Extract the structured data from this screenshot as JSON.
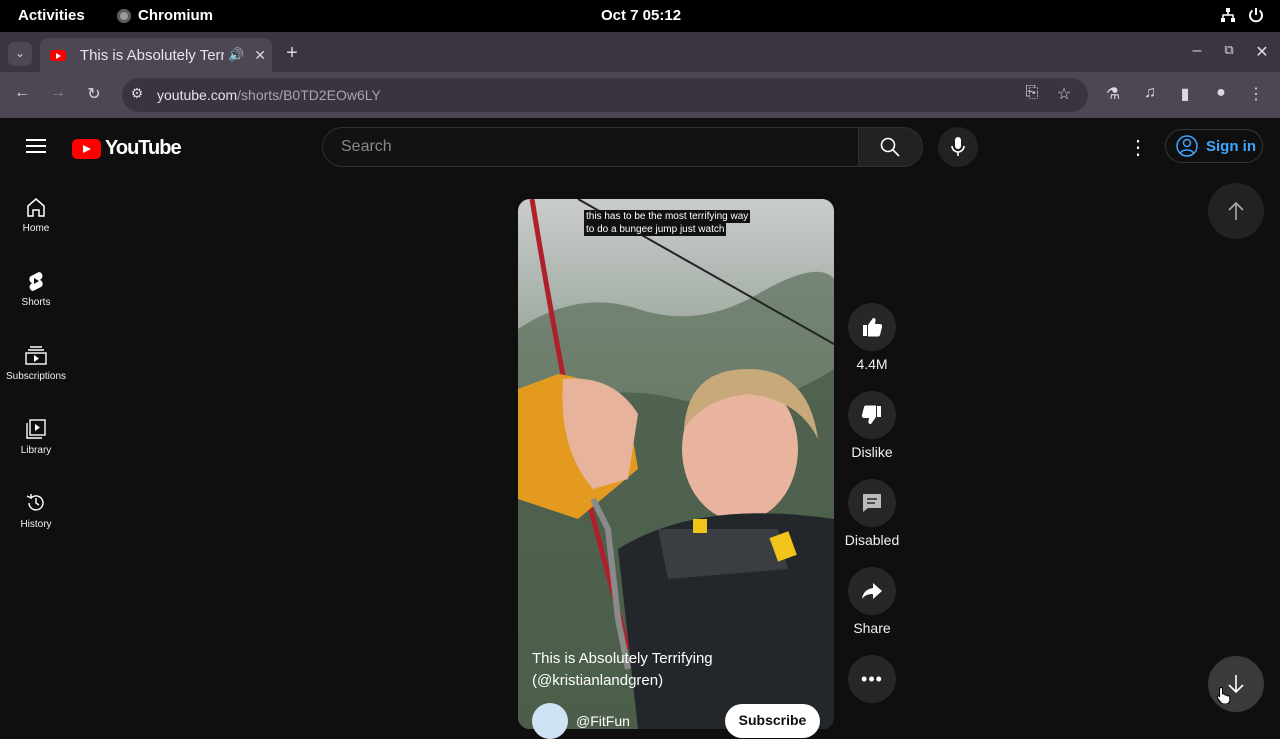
{
  "system": {
    "activities": "Activities",
    "app_name": "Chromium",
    "clock": "Oct 7  05:12"
  },
  "browser": {
    "tab_title": "This is Absolutely Terrifying",
    "url_host": "youtube.com",
    "url_path": "/shorts/B0TD2EOw6LY"
  },
  "youtube": {
    "logo_text": "YouTube",
    "search_placeholder": "Search",
    "sign_in": "Sign in",
    "sidebar": [
      {
        "label": "Home",
        "icon": "home-icon"
      },
      {
        "label": "Shorts",
        "icon": "shorts-icon"
      },
      {
        "label": "Subscriptions",
        "icon": "subscriptions-icon"
      },
      {
        "label": "Library",
        "icon": "library-icon"
      },
      {
        "label": "History",
        "icon": "history-icon"
      }
    ],
    "short": {
      "caption_line1": "this has to be the most terrifying way",
      "caption_line2": "to do a bungee jump just watch",
      "title_line1": "This is Absolutely Terrifying",
      "title_line2": "(@kristianlandgren)",
      "channel": "@FitFun",
      "subscribe": "Subscribe"
    },
    "actions": {
      "likes": "4.4M",
      "dislike": "Dislike",
      "comments": "Disabled",
      "share": "Share"
    }
  },
  "colors": {
    "accent": "#3ea6ff",
    "brand": "#ff0000",
    "background": "#0f0f0f"
  }
}
